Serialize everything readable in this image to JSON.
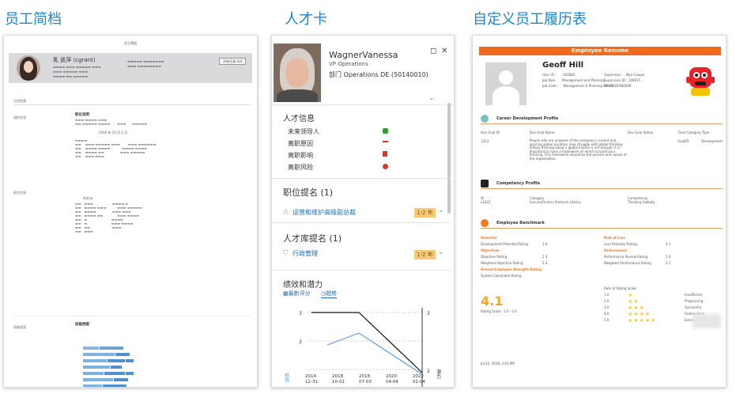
{
  "headings": {
    "p1": "员工简档",
    "p2": "人才卡",
    "p3": "自定义员工履历表"
  },
  "p1": {
    "title": "员工简档",
    "header_name": "乳 凯萍 (cgrant)",
    "header_button": "开始记录 4/4",
    "section_job": "工作信息",
    "label_org": "组织信息",
    "label_job": "职位信息",
    "label_skill": "技能档案",
    "job_date": "2010 年 10 月 1 日",
    "org_title": "职位说明",
    "pos_status": "Active",
    "skill_title": "技能档案"
  },
  "p2": {
    "name": "WagnerVanessa",
    "role": "VP Operations",
    "dept": "部门 Operations DE (50140010)",
    "talent_info": "人才信息",
    "items": [
      "未来领导人",
      "离职原因",
      "离职影响",
      "离职风险"
    ],
    "position_nomination": "职位提名 (1)",
    "position_link": "运营和维护高级副总裁",
    "position_tag": "1-2 年",
    "pool_nomination": "人才库提名 (1)",
    "pool_link": "行政管理",
    "pool_tag": "1-2 年",
    "perf_title": "绩效和潜力",
    "tab_latest": "最新评分",
    "tab_trend": "趋势",
    "yaxis_left": "绩效",
    "yaxis_right": "潜力",
    "colors": {
      "flag_green": "#3a9a3a",
      "flag_red": "#d23b2b",
      "tag_bg": "#f5c87a",
      "link": "#1a6fb8"
    }
  },
  "p3": {
    "banner": "Employee Resume",
    "name": "Geoff Hill",
    "user_id_label": "User ID :",
    "user_id": "102881",
    "job_role_label": "Job Role :",
    "job_role": "Management and Planning",
    "job_code_label": "Job Code :",
    "job_code": "Management & Planning (50070059)",
    "supervisor_label": "Supervisor :",
    "supervisor": "Mya Cooper",
    "supervisor_id_label": "Supervisor ID :",
    "supervisor_id": "100015",
    "hr_id_label": "HR ID :",
    "hr_id": "82096",
    "career_title": "Career Development Profile",
    "career_cols": [
      "Dev Goal ID",
      "Dev Goal Name",
      "Dev Goal Status",
      "Goal Category",
      "Type"
    ],
    "career_row": [
      "1253",
      "People who are unaware of the company's current and aspiring global positions may struggle with global thinking. Simply thinking about a global impact is not enough; it is important to have a framework on which to build your thinking. This framework should be the policies and values of the organization.",
      "",
      "Goal65",
      "Development"
    ],
    "competency_title": "Competency Profile",
    "comp_cols": [
      "ID",
      "Category",
      "Competency"
    ],
    "comp_row": [
      "L4322",
      "SuccessFactors Premium Library",
      "Thinking Globally"
    ],
    "bench_title": "Employee Benchmark",
    "potential_title": "Potential",
    "potential_rows": [
      [
        "Development Potential Rating",
        "3.0"
      ]
    ],
    "objectives_title": "Objectives",
    "objective_rows": [
      [
        "Objective Rating",
        "2.3"
      ],
      [
        "Weighted Objective Rating",
        "2.3"
      ]
    ],
    "risk_title": "Risk of Loss",
    "risk_rows": [
      [
        "Loss Potential Rating",
        "4.1"
      ]
    ],
    "perf_title": "Performance",
    "perf_rows": [
      [
        "Performance Review Rating",
        "2.0"
      ],
      [
        "Weighted Performance Rating",
        "4.1"
      ]
    ],
    "overall_title": "Overall Employee Strength Rating",
    "calc_label": "System Calculated Rating",
    "score": "4.1",
    "scale": "Rating Scale : 1.0 - 5.0",
    "scale_title": "Rate of Rating Scale",
    "scale_rows": [
      [
        "1.0",
        "Insufficient"
      ],
      [
        "2.0",
        "Progressing"
      ],
      [
        "3.0",
        "Successful"
      ],
      [
        "4.0",
        "Outstanding"
      ],
      [
        "5.0",
        "Extraordinary"
      ]
    ],
    "date": "Jul 23, 2018, 2:01 PM",
    "accent": "#f06a1e"
  }
}
